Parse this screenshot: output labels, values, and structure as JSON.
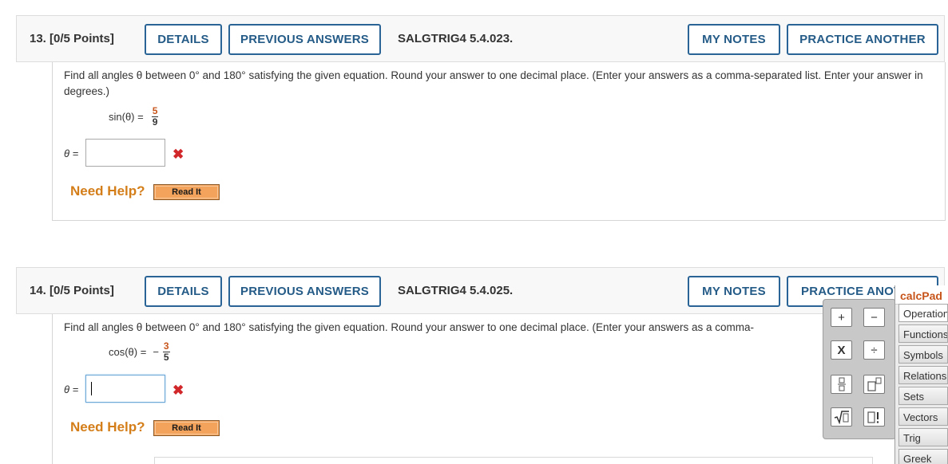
{
  "questions": [
    {
      "number": "13.",
      "points": "[0/5 Points]",
      "details_label": "DETAILS",
      "previous_answers_label": "PREVIOUS ANSWERS",
      "code": "SALGTRIG4 5.4.023.",
      "my_notes_label": "MY NOTES",
      "practice_label": "PRACTICE ANOTHER",
      "prompt": "Find all angles θ between 0° and 180° satisfying the given equation. Round your answer to one decimal place. (Enter your answers as a comma-separated list. Enter your answer in degrees.)",
      "eq_lhs": "sin(θ) =",
      "eq_sign": "",
      "eq_num": "5",
      "eq_den": "9",
      "theta_label": "θ =",
      "answer_value": "",
      "wrong_mark": "✖",
      "need_help": "Need Help?",
      "read_it": "Read It"
    },
    {
      "number": "14.",
      "points": "[0/5 Points]",
      "details_label": "DETAILS",
      "previous_answers_label": "PREVIOUS ANSWERS",
      "code": "SALGTRIG4 5.4.025.",
      "my_notes_label": "MY NOTES",
      "practice_label": "PRACTICE ANOT",
      "prompt": "Find all angles θ between 0° and 180° satisfying the given equation. Round your answer to one decimal place. (Enter your answers as a comma-",
      "eq_lhs": "cos(θ) =",
      "eq_sign": "−",
      "eq_num": "3",
      "eq_den": "5",
      "theta_label": "θ =",
      "answer_value": "",
      "wrong_mark": "✖",
      "need_help": "Need Help?",
      "read_it": "Read It"
    }
  ],
  "calcpad": {
    "title": "calcPad",
    "buttons": [
      "+",
      "−",
      "X",
      "÷",
      "▯/▯",
      "▯▯",
      "√▯",
      "▯!"
    ],
    "tabs": [
      "Operations",
      "Functions",
      "Symbols",
      "Relations",
      "Sets",
      "Vectors",
      "Trig",
      "Greek"
    ]
  },
  "colors": {
    "button_border": "#2a6496",
    "button_text": "#245b87",
    "need_help": "#d47e1a",
    "read_it_bg": "#f3a35b",
    "wrong_mark": "#d1262a",
    "fraction_numerator": "#c7551b"
  }
}
